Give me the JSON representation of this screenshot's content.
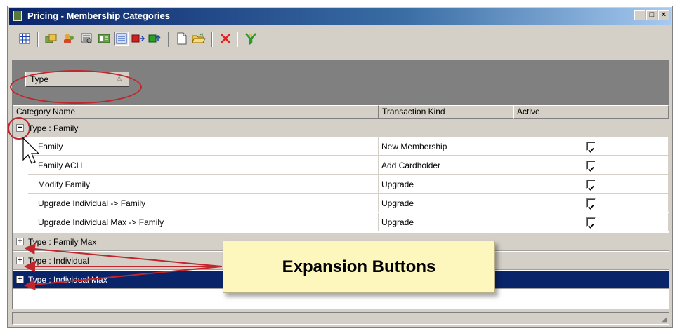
{
  "window": {
    "title": "Pricing - Membership Categories",
    "controls": {
      "minimize": "_",
      "maximize": "□",
      "close": "×"
    }
  },
  "toolbar": {
    "icons": [
      "grid-view-icon",
      "copy-icon",
      "users-icon",
      "settings-icon",
      "card-icon",
      "list-view-icon",
      "export-icon",
      "import-icon",
      "new-document-icon",
      "open-folder-icon",
      "delete-icon",
      "filter-icon"
    ]
  },
  "group_panel": {
    "group_field": "Type",
    "sort_indicator": "△"
  },
  "grid": {
    "columns": [
      "Category Name",
      "Transaction Kind",
      "Active"
    ],
    "groups": [
      {
        "label": "Type : Family",
        "expanded": true,
        "expander": "−",
        "rows": [
          {
            "name": "Family",
            "kind": "New Membership",
            "active": true
          },
          {
            "name": "Family ACH",
            "kind": "Add Cardholder",
            "active": true
          },
          {
            "name": "Modify Family",
            "kind": "Upgrade",
            "active": true
          },
          {
            "name": "Upgrade Individual -> Family",
            "kind": "Upgrade",
            "active": true
          },
          {
            "name": "Upgrade Individual Max -> Family",
            "kind": "Upgrade",
            "active": true
          }
        ]
      },
      {
        "label": "Type : Family Max",
        "expanded": false,
        "expander": "+"
      },
      {
        "label": "Type : Individual",
        "expanded": false,
        "expander": "+"
      },
      {
        "label": "Type : Individual Max",
        "expanded": false,
        "expander": "+",
        "selected": true
      }
    ]
  },
  "annotation": {
    "callout_text": "Expansion Buttons",
    "color": "#c0262b"
  },
  "colors": {
    "title_bar": "#0a246a",
    "selection": "#0a246a",
    "chrome": "#d4d0c8",
    "callout": "#fdf6bd"
  }
}
